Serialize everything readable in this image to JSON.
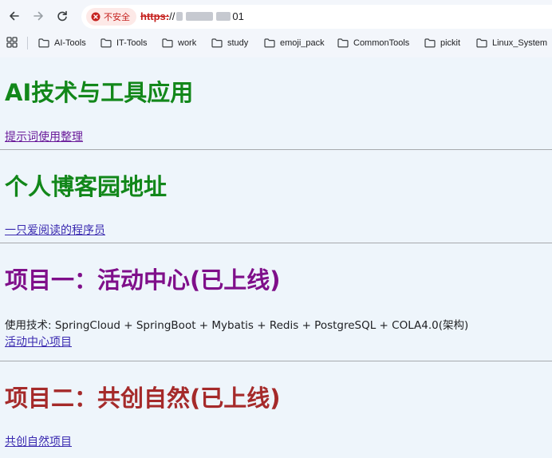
{
  "browser": {
    "security_label": "不安全",
    "url_scheme": "https:",
    "url_rest": "//",
    "url_tail": "01",
    "bookmarks": [
      "AI-Tools",
      "IT-Tools",
      "work",
      "study",
      "emoji_pack",
      "CommonTools",
      "pickit",
      "Linux_System"
    ]
  },
  "page": {
    "sections": [
      {
        "title": "AI技术与工具应用",
        "color": "#12871a",
        "link": "提示词使用整理"
      },
      {
        "title": "个人博客园地址",
        "color": "#12871a",
        "link": "一只爱阅读的程序员"
      },
      {
        "title": "项目一：活动中心(已上线)",
        "color": "#7f0f8a",
        "tech": "使用技术: SpringCloud + SpringBoot + Mybatis + Redis + PostgreSQL + COLA4.0(架构)",
        "link": "活动中心项目"
      },
      {
        "title": "项目二：共创自然(已上线)",
        "color": "#a52a2a",
        "link": "共创自然项目"
      }
    ]
  },
  "colors": {
    "page_background": "#eef5fb",
    "link": "#3a2ab0",
    "visited_link": "#6a1b9a",
    "insecure_red": "#c5221f"
  }
}
